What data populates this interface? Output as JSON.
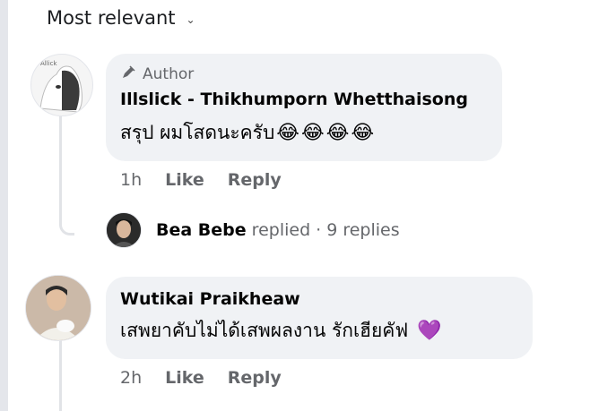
{
  "sort": {
    "label": "Most relevant",
    "icon": "chevron-down-icon"
  },
  "comments": [
    {
      "author_badge": "Author",
      "badge_icon": "pen-icon",
      "name": "Illslick - Thikhumporn Whetthaisong",
      "text": "สรุป ผมโสดนะครับ",
      "emojis": [
        "😂",
        "😂",
        "😂",
        "😂"
      ],
      "time": "1h",
      "like": "Like",
      "reply": "Reply"
    },
    {
      "name": "Wutikai Praikheaw",
      "text": "เสพยาคับไม่ได้เสพผลงาน รักเฮียคัฟ",
      "emojis": [
        "💜"
      ],
      "time": "2h",
      "like": "Like",
      "reply": "Reply"
    }
  ],
  "reply_summary": {
    "name": "Bea Bebe",
    "action": "replied",
    "count": "· 9 replies"
  },
  "colors": {
    "bubble": "#f0f2f5",
    "meta": "#65676b",
    "purple_heart": "#8a3ffc"
  }
}
